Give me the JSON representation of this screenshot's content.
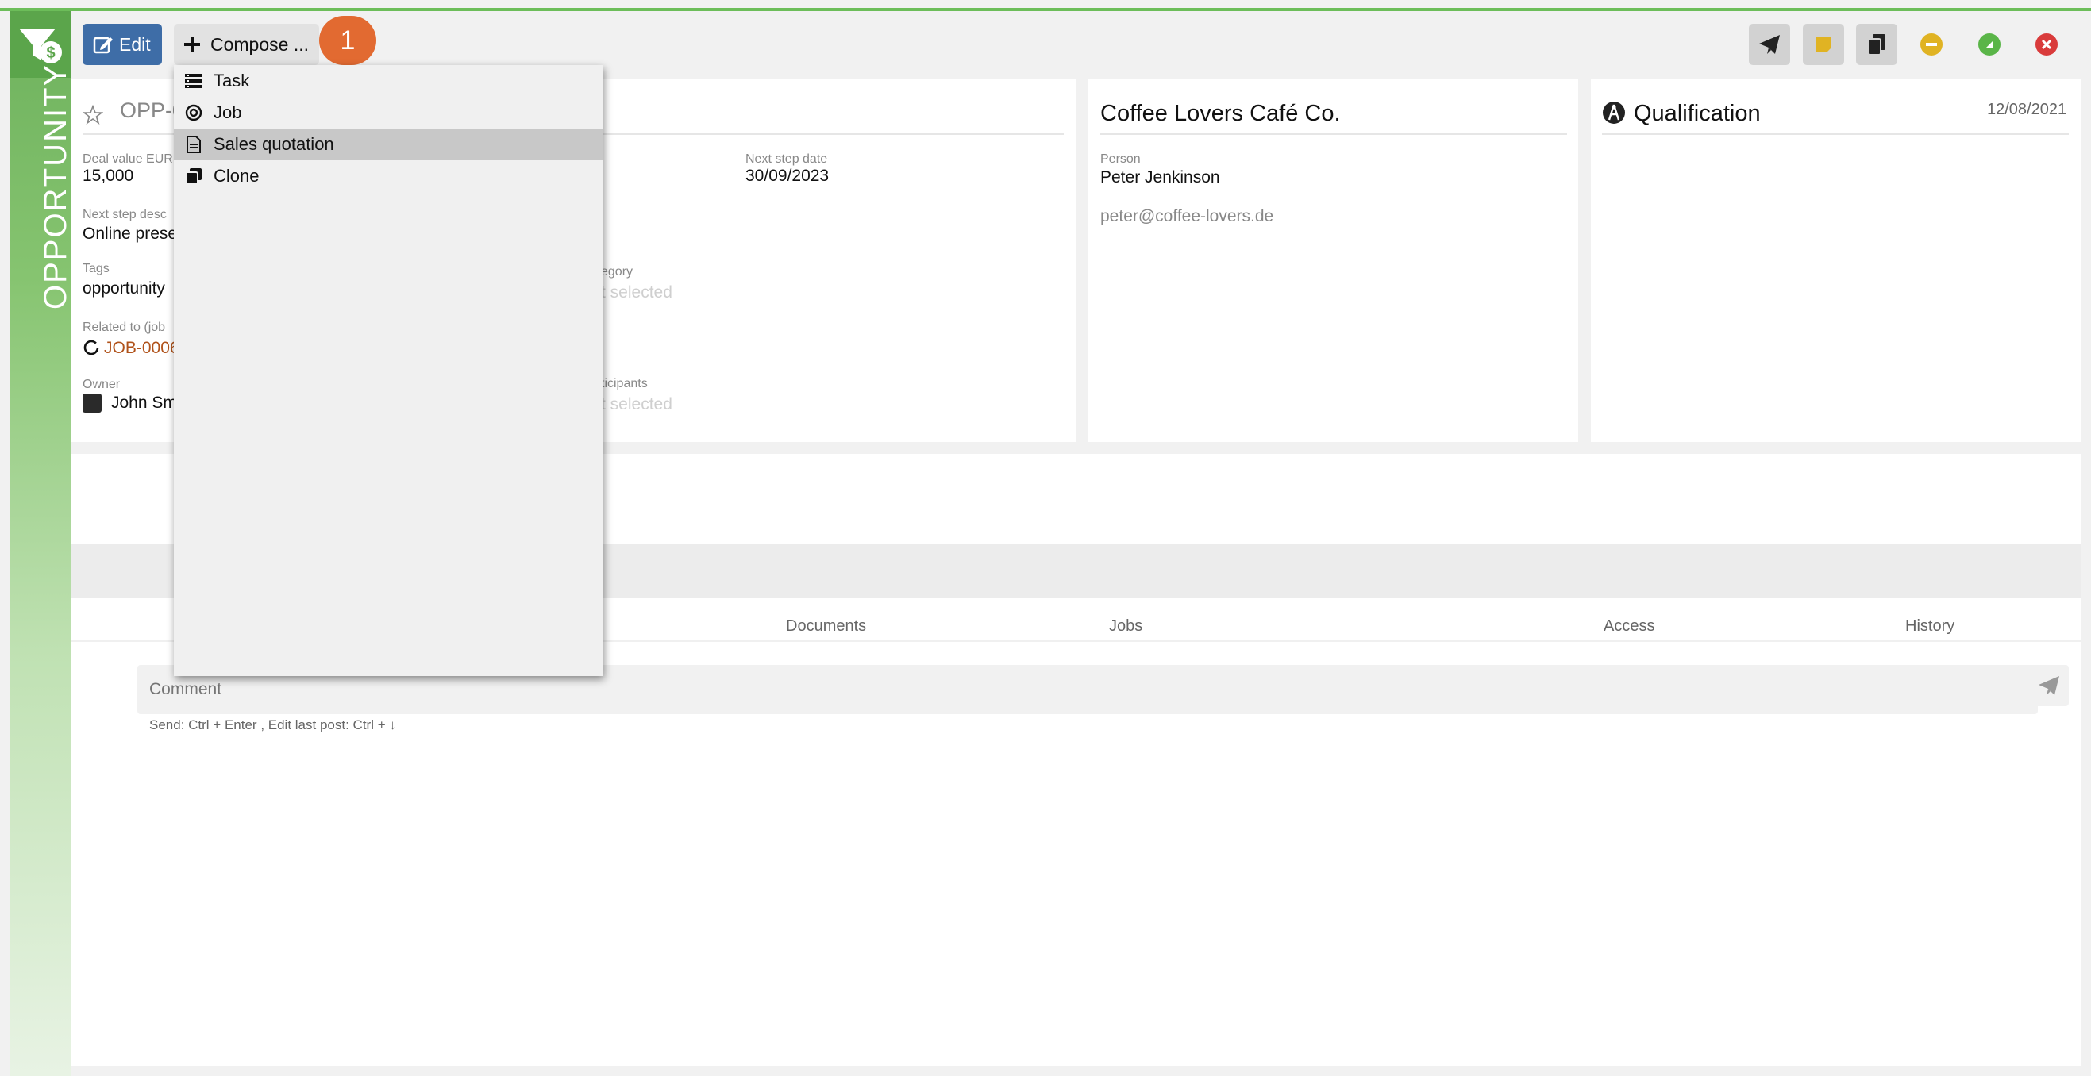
{
  "sidebar": {
    "label": "OPPORTUNITY",
    "logo_icon": "funnel-dollar-icon"
  },
  "toolbar": {
    "edit_label": "Edit",
    "compose_label": "Compose ...",
    "badge": "1",
    "send_icon": "paper-plane-icon",
    "note_icon": "sticky-note-icon",
    "copy_icon": "copy-icon"
  },
  "compose_menu": [
    {
      "icon": "task-list-icon",
      "label": "Task"
    },
    {
      "icon": "job-circle-icon",
      "label": "Job"
    },
    {
      "icon": "document-icon",
      "label": "Sales quotation",
      "selected": true
    },
    {
      "icon": "clone-icon",
      "label": "Clone"
    }
  ],
  "opportunity": {
    "id_partial": "OPP-0",
    "deal_value_label": "Deal value EUR",
    "deal_value": "15,000",
    "next_step_desc_label": "Next step desc",
    "next_step_desc": "Online prese",
    "tags_label": "Tags",
    "tags": "opportunity",
    "related_label": "Related to (job",
    "related_value": "JOB-0006",
    "owner_label": "Owner",
    "owner_value": "John Sm",
    "next_step_date_label": "Next step date",
    "next_step_date": "30/09/2023",
    "category_label": "egory",
    "category_value": "t selected",
    "participants_label": "ticipants",
    "participants_value": "t selected"
  },
  "contact": {
    "company": "Coffee Lovers Café Co.",
    "person_label": "Person",
    "person": "Peter Jenkinson",
    "email": "peter@coffee-lovers.de"
  },
  "stage": {
    "title": "Qualification",
    "date": "12/08/2021"
  },
  "tabs": [
    "Documents",
    "Jobs",
    "Access",
    "History"
  ],
  "comment": {
    "placeholder": "Comment",
    "hint": "Send: Ctrl + Enter , Edit last post: Ctrl + ↓"
  },
  "colors": {
    "accent": "#6cbd59",
    "primary": "#3e6da7",
    "badge": "#e26a31",
    "link": "#b0521a"
  }
}
